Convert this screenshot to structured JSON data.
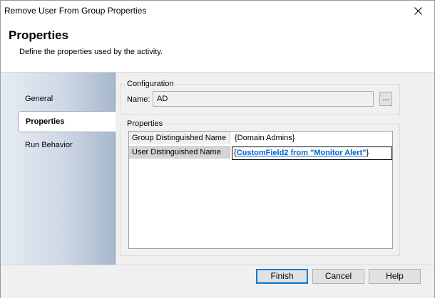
{
  "window": {
    "title": "Remove User From Group Properties",
    "close_icon": "close-icon"
  },
  "header": {
    "title": "Properties",
    "description": "Define the properties used by the activity."
  },
  "sidebar": {
    "items": [
      {
        "label": "General",
        "selected": false
      },
      {
        "label": "Properties",
        "selected": true
      },
      {
        "label": "Run Behavior",
        "selected": false
      }
    ]
  },
  "configuration": {
    "group_label": "Configuration",
    "name_label": "Name:",
    "name_value": "AD",
    "browse_label": "..."
  },
  "properties": {
    "group_label": "Properties",
    "rows": [
      {
        "name": "Group Distinguished Name",
        "value": "{Domain Admins}"
      },
      {
        "name": "User Distinguished Name",
        "value_open": "{",
        "value_link": "CustomField2 from \"Monitor Alert\"",
        "value_close": "}"
      }
    ]
  },
  "footer": {
    "finish": "Finish",
    "cancel": "Cancel",
    "help": "Help"
  },
  "colors": {
    "link": "#0066cc",
    "default_button_border": "#0078d7"
  }
}
